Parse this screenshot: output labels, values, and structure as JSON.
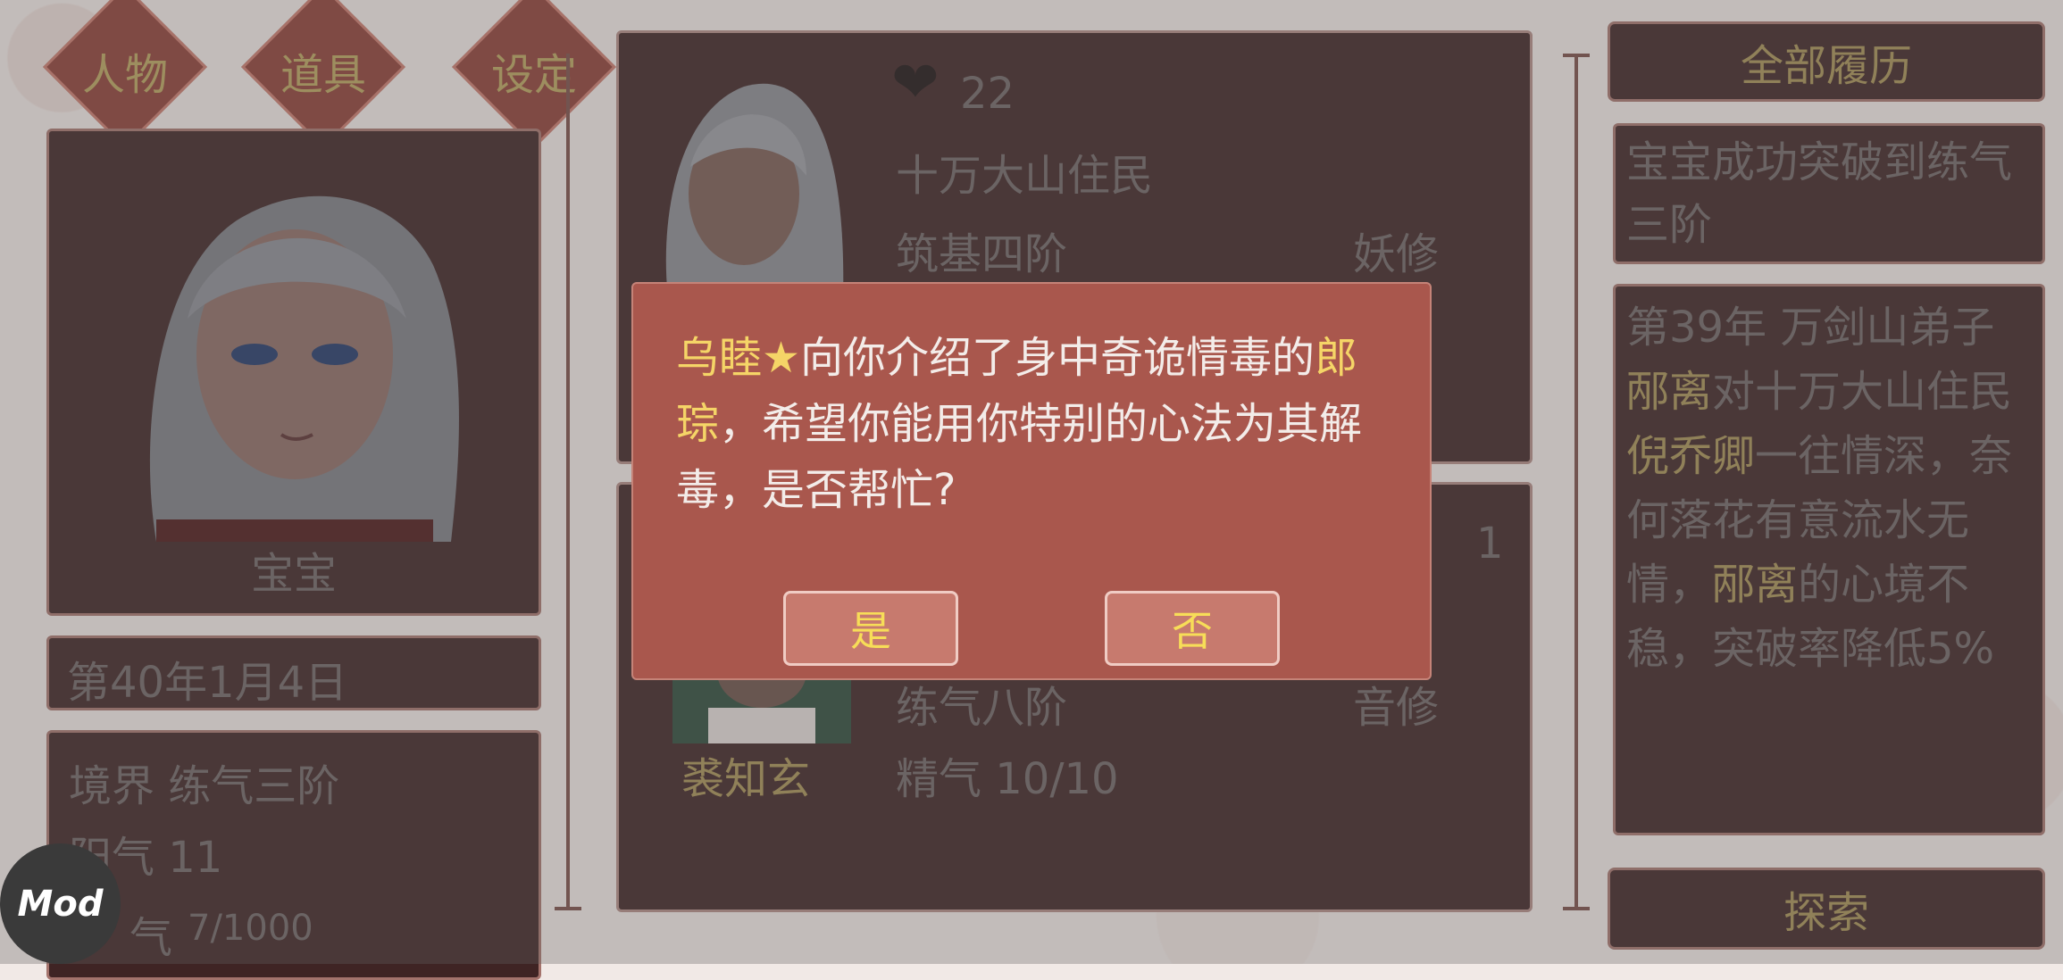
{
  "nav": {
    "character": "人物",
    "items": "道具",
    "settings": "设定"
  },
  "player": {
    "name": "宝宝",
    "date": "第40年1月4日",
    "realm": "境界 练气三阶",
    "yang": "阳气 11",
    "qi_prefix": "气",
    "qi_value": "7/1000"
  },
  "npc1": {
    "hearts": "22",
    "origin": "十万大山住民",
    "rank": "筑基四阶",
    "class": "妖修"
  },
  "npc2": {
    "count": "1",
    "name": "裘知玄",
    "rank": "练气八阶",
    "class": "音修",
    "essence": "精气 10/10"
  },
  "history": {
    "button": "全部履历",
    "entry1": "宝宝成功突破到练气三阶",
    "entry2": {
      "part1": "第39年 万剑山弟子",
      "name1": "邴离",
      "part2": "对十万大山住民",
      "name2": "倪乔卿",
      "part3": "一往情深，奈何落花有意流水无情，",
      "name3": "邴离",
      "part4": "的心境不稳，突破率降低5%"
    },
    "explore": "探索"
  },
  "dialog": {
    "name1": "乌睦★",
    "text1": "向你介绍了身中奇诡情毒的",
    "name2": "郎琮",
    "text2": "，希望你能用你特别的心法为其解毒，是否帮忙?",
    "yes": "是",
    "no": "否"
  },
  "mod_badge": "Mod"
}
